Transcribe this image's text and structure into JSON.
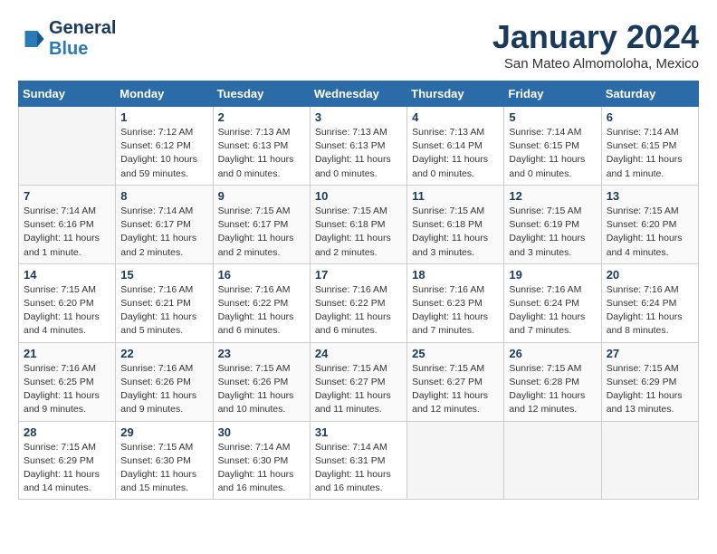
{
  "logo": {
    "line1": "General",
    "line2": "Blue"
  },
  "title": "January 2024",
  "location": "San Mateo Almomoloha, Mexico",
  "weekdays": [
    "Sunday",
    "Monday",
    "Tuesday",
    "Wednesday",
    "Thursday",
    "Friday",
    "Saturday"
  ],
  "weeks": [
    [
      {
        "day": "",
        "info": ""
      },
      {
        "day": "1",
        "info": "Sunrise: 7:12 AM\nSunset: 6:12 PM\nDaylight: 10 hours\nand 59 minutes."
      },
      {
        "day": "2",
        "info": "Sunrise: 7:13 AM\nSunset: 6:13 PM\nDaylight: 11 hours\nand 0 minutes."
      },
      {
        "day": "3",
        "info": "Sunrise: 7:13 AM\nSunset: 6:13 PM\nDaylight: 11 hours\nand 0 minutes."
      },
      {
        "day": "4",
        "info": "Sunrise: 7:13 AM\nSunset: 6:14 PM\nDaylight: 11 hours\nand 0 minutes."
      },
      {
        "day": "5",
        "info": "Sunrise: 7:14 AM\nSunset: 6:15 PM\nDaylight: 11 hours\nand 0 minutes."
      },
      {
        "day": "6",
        "info": "Sunrise: 7:14 AM\nSunset: 6:15 PM\nDaylight: 11 hours\nand 1 minute."
      }
    ],
    [
      {
        "day": "7",
        "info": "Sunrise: 7:14 AM\nSunset: 6:16 PM\nDaylight: 11 hours\nand 1 minute."
      },
      {
        "day": "8",
        "info": "Sunrise: 7:14 AM\nSunset: 6:17 PM\nDaylight: 11 hours\nand 2 minutes."
      },
      {
        "day": "9",
        "info": "Sunrise: 7:15 AM\nSunset: 6:17 PM\nDaylight: 11 hours\nand 2 minutes."
      },
      {
        "day": "10",
        "info": "Sunrise: 7:15 AM\nSunset: 6:18 PM\nDaylight: 11 hours\nand 2 minutes."
      },
      {
        "day": "11",
        "info": "Sunrise: 7:15 AM\nSunset: 6:18 PM\nDaylight: 11 hours\nand 3 minutes."
      },
      {
        "day": "12",
        "info": "Sunrise: 7:15 AM\nSunset: 6:19 PM\nDaylight: 11 hours\nand 3 minutes."
      },
      {
        "day": "13",
        "info": "Sunrise: 7:15 AM\nSunset: 6:20 PM\nDaylight: 11 hours\nand 4 minutes."
      }
    ],
    [
      {
        "day": "14",
        "info": "Sunrise: 7:15 AM\nSunset: 6:20 PM\nDaylight: 11 hours\nand 4 minutes."
      },
      {
        "day": "15",
        "info": "Sunrise: 7:16 AM\nSunset: 6:21 PM\nDaylight: 11 hours\nand 5 minutes."
      },
      {
        "day": "16",
        "info": "Sunrise: 7:16 AM\nSunset: 6:22 PM\nDaylight: 11 hours\nand 6 minutes."
      },
      {
        "day": "17",
        "info": "Sunrise: 7:16 AM\nSunset: 6:22 PM\nDaylight: 11 hours\nand 6 minutes."
      },
      {
        "day": "18",
        "info": "Sunrise: 7:16 AM\nSunset: 6:23 PM\nDaylight: 11 hours\nand 7 minutes."
      },
      {
        "day": "19",
        "info": "Sunrise: 7:16 AM\nSunset: 6:24 PM\nDaylight: 11 hours\nand 7 minutes."
      },
      {
        "day": "20",
        "info": "Sunrise: 7:16 AM\nSunset: 6:24 PM\nDaylight: 11 hours\nand 8 minutes."
      }
    ],
    [
      {
        "day": "21",
        "info": "Sunrise: 7:16 AM\nSunset: 6:25 PM\nDaylight: 11 hours\nand 9 minutes."
      },
      {
        "day": "22",
        "info": "Sunrise: 7:16 AM\nSunset: 6:26 PM\nDaylight: 11 hours\nand 9 minutes."
      },
      {
        "day": "23",
        "info": "Sunrise: 7:15 AM\nSunset: 6:26 PM\nDaylight: 11 hours\nand 10 minutes."
      },
      {
        "day": "24",
        "info": "Sunrise: 7:15 AM\nSunset: 6:27 PM\nDaylight: 11 hours\nand 11 minutes."
      },
      {
        "day": "25",
        "info": "Sunrise: 7:15 AM\nSunset: 6:27 PM\nDaylight: 11 hours\nand 12 minutes."
      },
      {
        "day": "26",
        "info": "Sunrise: 7:15 AM\nSunset: 6:28 PM\nDaylight: 11 hours\nand 12 minutes."
      },
      {
        "day": "27",
        "info": "Sunrise: 7:15 AM\nSunset: 6:29 PM\nDaylight: 11 hours\nand 13 minutes."
      }
    ],
    [
      {
        "day": "28",
        "info": "Sunrise: 7:15 AM\nSunset: 6:29 PM\nDaylight: 11 hours\nand 14 minutes."
      },
      {
        "day": "29",
        "info": "Sunrise: 7:15 AM\nSunset: 6:30 PM\nDaylight: 11 hours\nand 15 minutes."
      },
      {
        "day": "30",
        "info": "Sunrise: 7:14 AM\nSunset: 6:30 PM\nDaylight: 11 hours\nand 16 minutes."
      },
      {
        "day": "31",
        "info": "Sunrise: 7:14 AM\nSunset: 6:31 PM\nDaylight: 11 hours\nand 16 minutes."
      },
      {
        "day": "",
        "info": ""
      },
      {
        "day": "",
        "info": ""
      },
      {
        "day": "",
        "info": ""
      }
    ]
  ]
}
